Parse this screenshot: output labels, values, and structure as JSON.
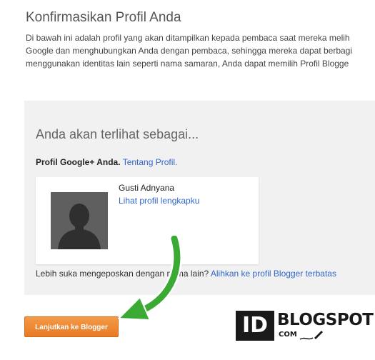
{
  "page": {
    "title": "Konfirmasikan Profil Anda",
    "intro_lines": [
      "Di bawah ini adalah profil yang akan ditampilkan kepada pembaca saat mereka melih",
      "Google dan menghubungkan Anda dengan pembaca, sehingga mereka dapat berbagi",
      "menggunakan identitas lain seperti nama samaran, Anda dapat memilih Profil Blogge"
    ]
  },
  "panel": {
    "heading": "Anda akan terlihat sebagai...",
    "profile_label": "Profil Google+ Anda.",
    "about_profile_link": "Tentang Profil.",
    "profile": {
      "name": "Gusti Adnyana",
      "view_profile_link": "Lihat profil lengkapku"
    },
    "alternative_prompt": "Lebih suka mengeposkan dengan nama lain?",
    "switch_link": "Alihkan ke profil Blogger terbatas"
  },
  "actions": {
    "continue_label": "Lanjutkan ke Blogger"
  },
  "watermark": {
    "id": "ID",
    "blogspot": "BLOGSPOT",
    "com": "COM"
  },
  "colors": {
    "link": "#3366cc",
    "panel_bg": "#f1f1f1",
    "button_orange": "#ec8530",
    "arrow_green": "#3aaa35"
  },
  "icons": {
    "avatar": "default-person-silhouette",
    "annotation": "curved-green-arrow",
    "watermark_pen": "pen-icon"
  }
}
